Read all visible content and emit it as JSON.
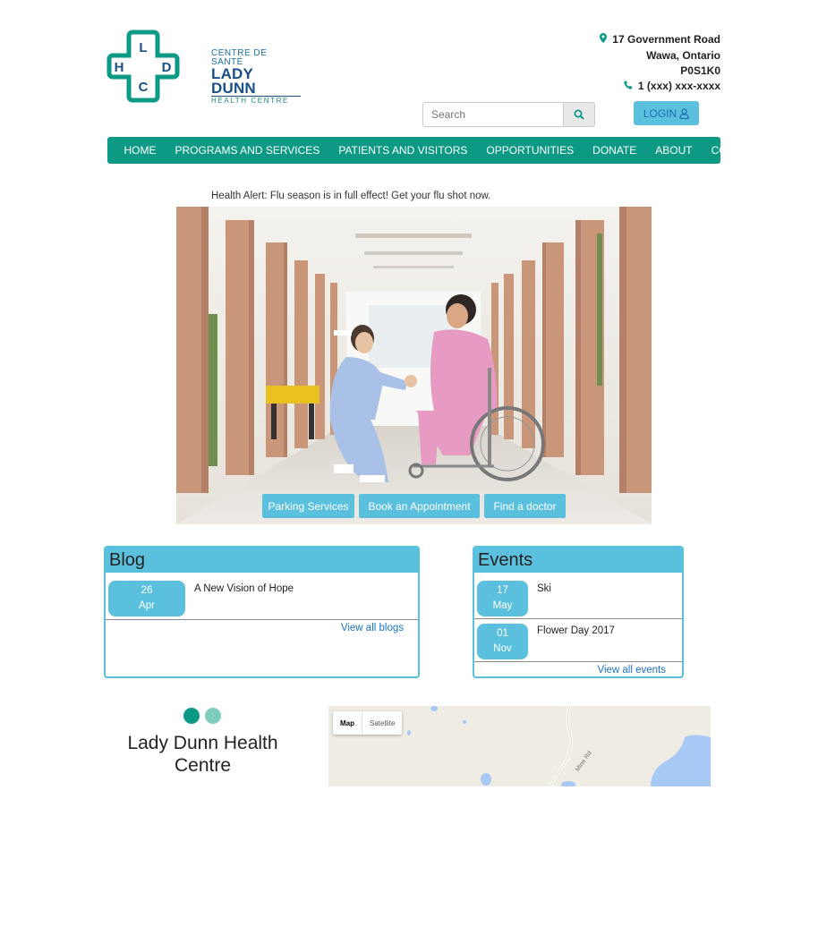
{
  "logo": {
    "letters": [
      "L",
      "H",
      "D",
      "C"
    ],
    "name_fr": "CENTRE DE SANTÉ",
    "name_en": "LADY DUNN",
    "name_sub": "HEALTH CENTRE"
  },
  "address": {
    "line1": "17 Government Road",
    "line2": "Wawa, Ontario",
    "line3": "P0S1K0",
    "phone": "1 (xxx) xxx-xxxx"
  },
  "search": {
    "placeholder": "Search"
  },
  "login": {
    "label": "LOGIN"
  },
  "nav": {
    "items": [
      "HOME",
      "PROGRAMS AND SERVICES",
      "PATIENTS AND VISITORS",
      "OPPORTUNITIES",
      "DONATE",
      "ABOUT",
      "CONTACT"
    ]
  },
  "alert": {
    "text": "Health Alert: Flu season is in full effect! Get your flu shot now."
  },
  "hero": {
    "buttons": [
      "Parking Services",
      "Book an Appointment",
      "Find a doctor"
    ]
  },
  "blog": {
    "title": "Blog",
    "posts": [
      {
        "day": "26",
        "month": "Apr",
        "title": "A New Vision of Hope"
      }
    ],
    "view_all": "View all blogs"
  },
  "events": {
    "title": "Events",
    "items": [
      {
        "day": "17",
        "month": "May",
        "title": "Ski"
      },
      {
        "day": "01",
        "month": "Nov",
        "title": "Flower Day 2017"
      }
    ],
    "view_all": "View all events"
  },
  "footer": {
    "title": "Lady Dunn Health Centre"
  },
  "map": {
    "tab_map": "Map",
    "tab_satellite": "Satellite",
    "road_label": "Mine Rd"
  },
  "colors": {
    "brand_green": "#0c9a84",
    "accent_blue": "#5bc0de",
    "link_blue": "#1a73c8"
  },
  "icons": [
    "map-marker-icon",
    "phone-icon",
    "search-icon",
    "user-icon"
  ]
}
